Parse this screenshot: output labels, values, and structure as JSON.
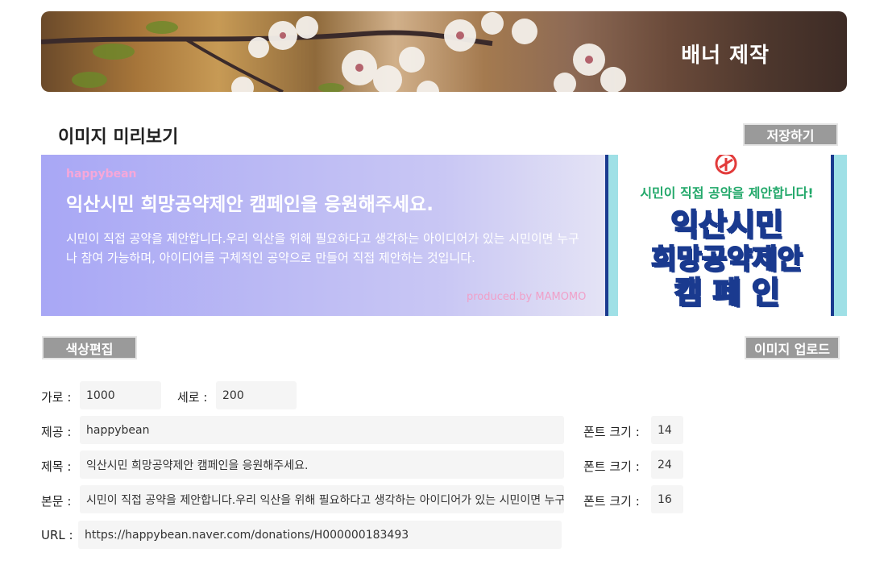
{
  "header": {
    "title": "배너 제작"
  },
  "preview_section": {
    "title": "이미지 미리보기",
    "save_label": "저장하기"
  },
  "preview": {
    "provider": "happybean",
    "title": "익산시민 희망공약제안 캠페인을 응원해주세요.",
    "body": "시민이 직접 공약을 제안합니다.우리 익산을 위해 필요하다고 생각하는 아이디어가 있는 시민이면 누구나 참여 가능하며, 아이디어를 구체적인 공약으로 만들어 직접 제안하는 것입니다.",
    "credit": "produced.by MAMOMO",
    "poster": {
      "subtitle": "시민이 직접 공약을 제안합니다!",
      "line1": "익산시민",
      "line2": "희망공약제안",
      "line3": "캠 페 인"
    }
  },
  "toolbar": {
    "color_edit_label": "색상편집",
    "upload_label": "이미지 업로드"
  },
  "form": {
    "width_label": "가로 :",
    "width_value": "1000",
    "height_label": "세로 :",
    "height_value": "200",
    "provider_label": "제공 :",
    "provider_value": "happybean",
    "title_label": "제목 :",
    "title_value": "익산시민 희망공약제안 캠페인을 응원해주세요.",
    "body_label": "본문 :",
    "body_value": "시민이 직접 공약을 제안합니다.우리 익산을 위해 필요하다고 생각하는 아이디어가 있는 시민이면 누구나 참여 가능하며",
    "url_label": "URL :",
    "url_value": "https://happybean.naver.com/donations/H000000183493",
    "font_size_label": "폰트 크기 :",
    "provider_font_size": "14",
    "title_font_size": "24",
    "body_font_size": "16"
  },
  "colors": {
    "accent_gray": "#9a9a9a",
    "preview_gradient_start": "#a8a7f5",
    "provider_pink": "#f7a7d9",
    "poster_green": "#22a86a",
    "poster_blue": "#1a3a8f",
    "poster_border": "#9fe0e6"
  }
}
